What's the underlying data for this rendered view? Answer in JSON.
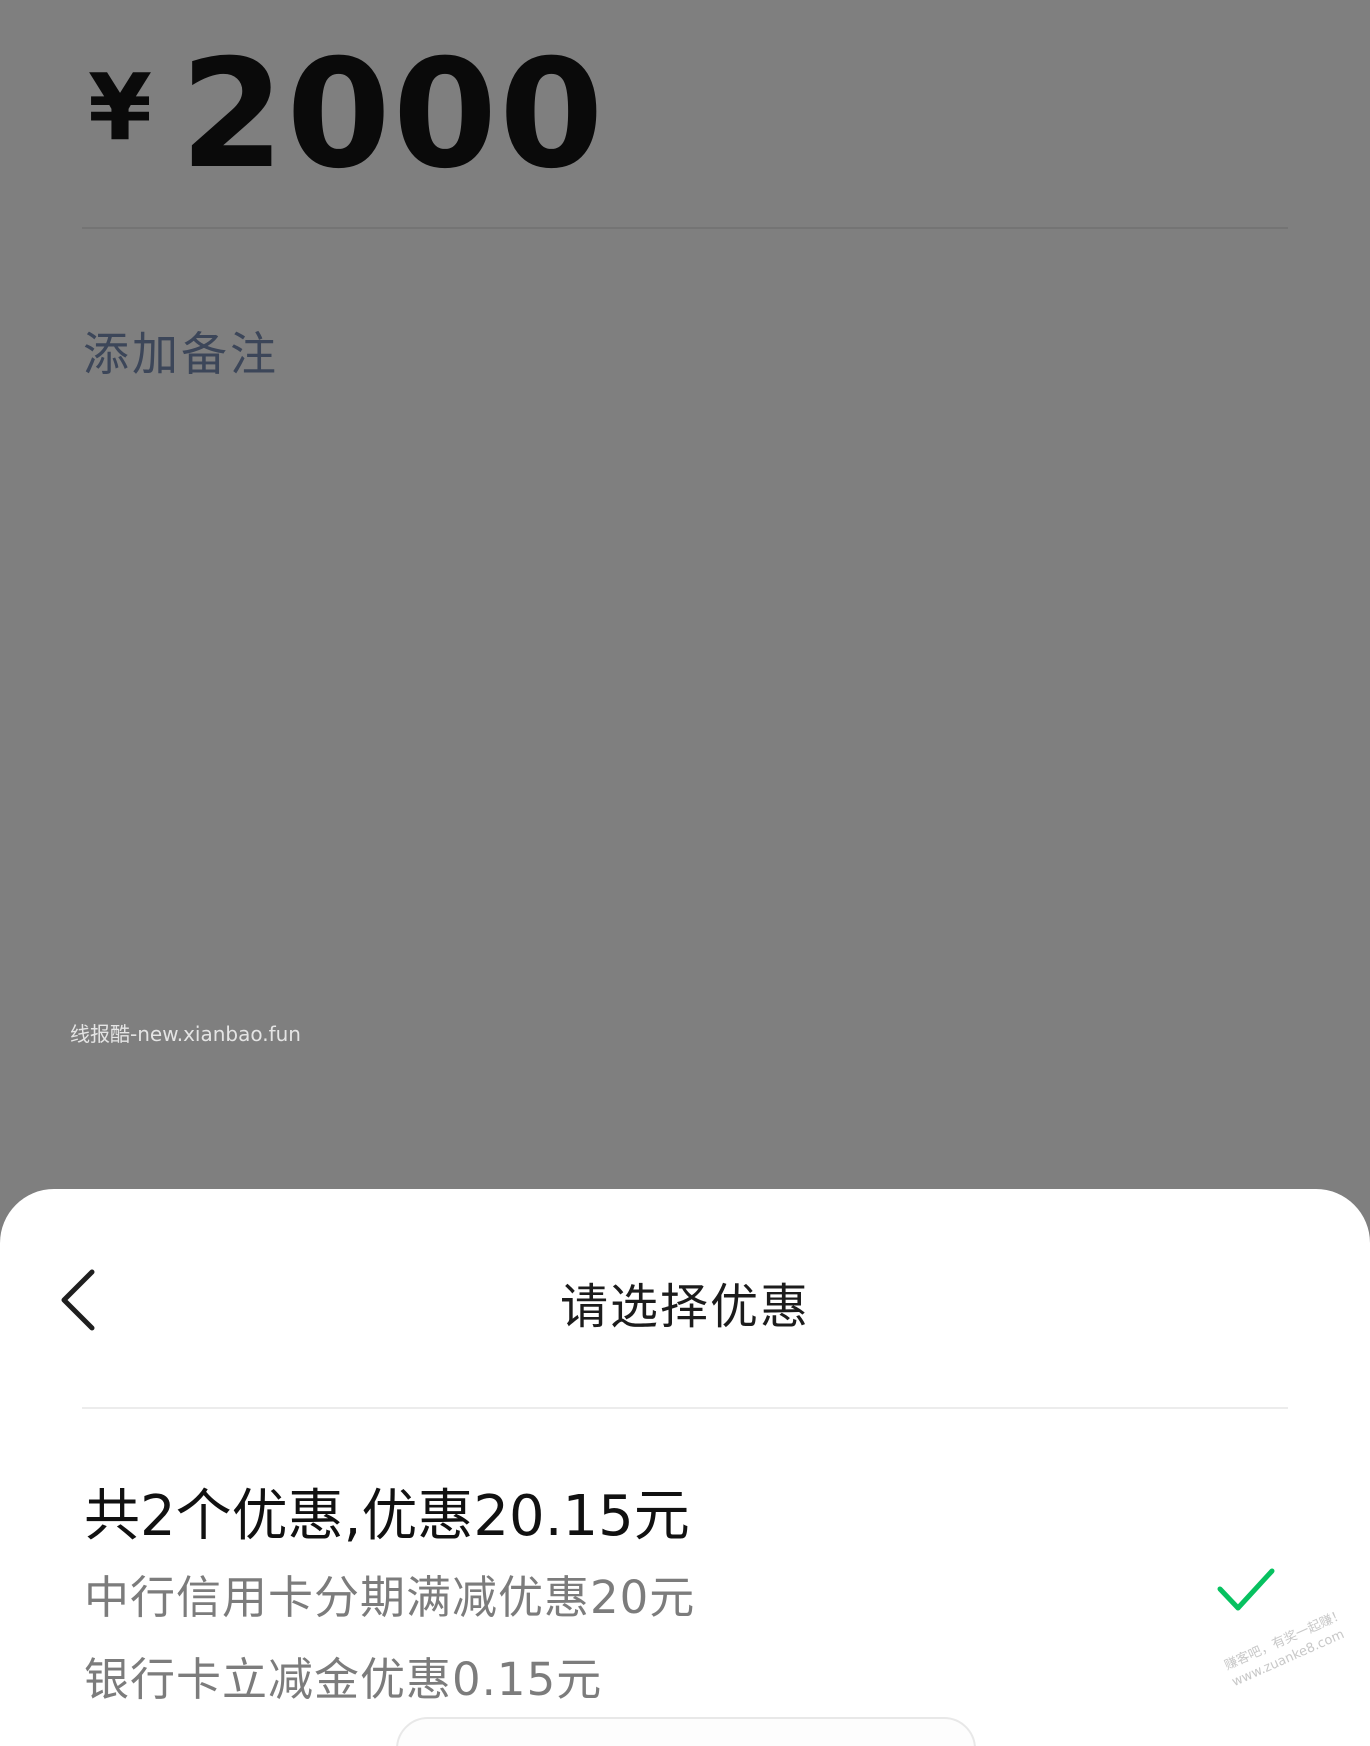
{
  "payment": {
    "currency_symbol": "¥",
    "amount": "2000",
    "add_note_label": "添加备注"
  },
  "watermark": "线报酷-new.xianbao.fun",
  "discount_sheet": {
    "back_icon": "chevron-left-icon",
    "title": "请选择优惠",
    "summary": "共2个优惠,优惠20.15元",
    "selected": true,
    "check_icon": "check-icon",
    "check_color": "#07c160",
    "promotions": [
      "中行信用卡分期满减优惠20元",
      "银行卡立减金优惠0.15元"
    ]
  },
  "stamp": {
    "line1": "赚客吧，有奖一起赚！",
    "line2": "www.zuanke8.com"
  }
}
